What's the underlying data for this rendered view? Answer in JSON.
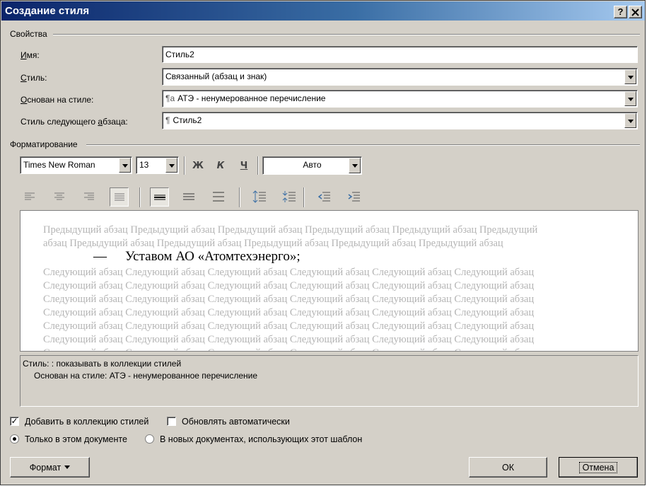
{
  "title": "Создание стиля",
  "title_buttons": {
    "help": "?",
    "close": "X"
  },
  "properties": {
    "group_label": "Свойства",
    "name_label": "Имя:",
    "name_value": "Стиль2",
    "type_label": "Стиль:",
    "type_value": "Связанный (абзац и знак)",
    "based_label": "Основан на стиле:",
    "based_value": "АТЭ - ненумерованное перечисление",
    "next_label": "Стиль следующего абзаца:",
    "next_value": "Стиль2"
  },
  "formatting": {
    "group_label": "Форматирование",
    "font": "Times New Roman",
    "size": "13",
    "bold": "Ж",
    "italic": "К",
    "underline": "Ч",
    "color": "Авто"
  },
  "preview": {
    "prev_line1": "Предыдущий абзац Предыдущий абзац Предыдущий абзац Предыдущий абзац Предыдущий абзац Предыдущий",
    "prev_line2": "абзац Предыдущий абзац Предыдущий абзац Предыдущий абзац Предыдущий абзац Предыдущий абзац",
    "dash": "—",
    "main_text": "Уставом АО «Атомтехэнерго»;",
    "next_line": "Следующий абзац Следующий абзац Следующий абзац Следующий абзац Следующий абзац Следующий абзац"
  },
  "description": {
    "line1": "Стиль: : показывать в коллекции стилей",
    "line2": "Основан на стиле: АТЭ - ненумерованное перечисление"
  },
  "options": {
    "add_to_gallery": "Добавить в коллекцию стилей",
    "add_to_gallery_checked": true,
    "auto_update": "Обновлять автоматически",
    "auto_update_checked": false,
    "only_this_doc": "Только в этом документе",
    "new_docs": "В новых документах, использующих этот шаблон",
    "selected_scope": "only_this_doc"
  },
  "buttons": {
    "format": "Формат",
    "ok": "ОК",
    "cancel": "Отмена"
  },
  "colors": {
    "title_start": "#0a246a",
    "title_end": "#a6caf0",
    "dialog_bg": "#d4d0c8",
    "ghost_text": "#b4b4b4"
  }
}
